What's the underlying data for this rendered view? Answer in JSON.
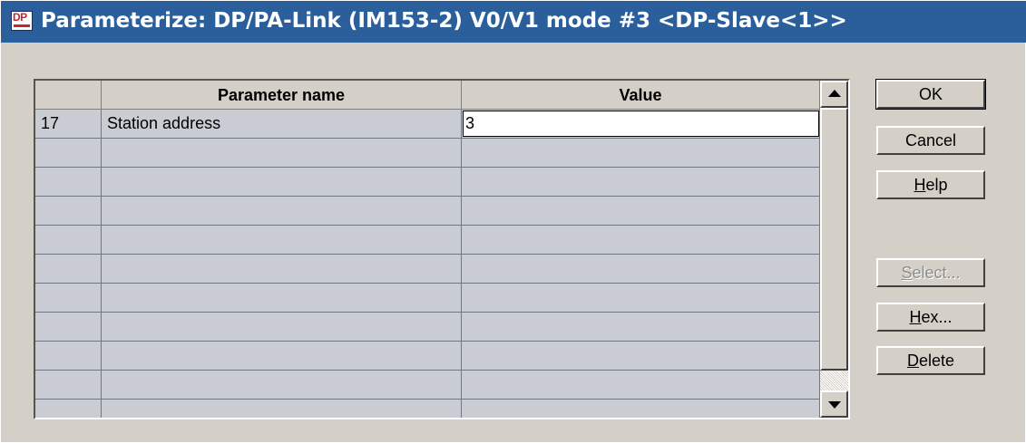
{
  "window": {
    "title": "Parameterize: DP/PA-Link (IM153-2) V0/V1 mode #3  <DP-Slave<1>>",
    "icon_text": "DP"
  },
  "grid": {
    "columns": [
      "",
      "Parameter name",
      "Value"
    ],
    "rows": [
      {
        "num": "17",
        "name": "Station address",
        "value": "3"
      },
      {
        "num": "",
        "name": "",
        "value": ""
      },
      {
        "num": "",
        "name": "",
        "value": ""
      },
      {
        "num": "",
        "name": "",
        "value": ""
      },
      {
        "num": "",
        "name": "",
        "value": ""
      },
      {
        "num": "",
        "name": "",
        "value": ""
      },
      {
        "num": "",
        "name": "",
        "value": ""
      },
      {
        "num": "",
        "name": "",
        "value": ""
      },
      {
        "num": "",
        "name": "",
        "value": ""
      },
      {
        "num": "",
        "name": "",
        "value": ""
      },
      {
        "num": "",
        "name": "",
        "value": ""
      }
    ]
  },
  "buttons": {
    "ok": "OK",
    "cancel": "Cancel",
    "help_u": "H",
    "help_rest": "elp",
    "select_u": "S",
    "select_rest": "elect...",
    "hex_u": "H",
    "hex_rest": "ex...",
    "delete_u": "D",
    "delete_rest": "elete"
  },
  "colors": {
    "titlebar": "#2a5f9c",
    "dialog_bg": "#d4d0c8",
    "grid_bg": "#c9cdd3"
  }
}
